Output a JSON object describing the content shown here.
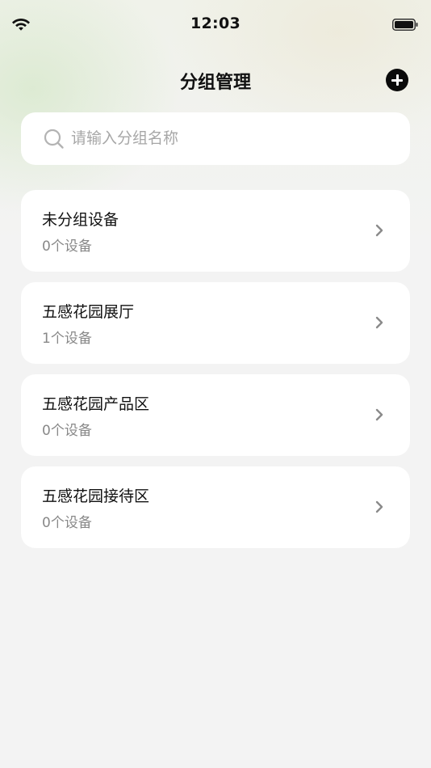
{
  "status_bar": {
    "time": "12:03"
  },
  "header": {
    "title": "分组管理",
    "add_icon": "plus-circle-icon"
  },
  "search": {
    "placeholder": "请输入分组名称",
    "value": "",
    "icon": "search-icon"
  },
  "groups": [
    {
      "name": "未分组设备",
      "count": "0个设备"
    },
    {
      "name": "五感花园展厅",
      "count": "1个设备"
    },
    {
      "name": "五感花园产品区",
      "count": "0个设备"
    },
    {
      "name": "五感花园接待区",
      "count": "0个设备"
    }
  ],
  "colors": {
    "background": "#f3f3f3",
    "card": "#ffffff",
    "primary_text": "#111111",
    "secondary_text": "#888888",
    "placeholder": "#a7a7a7"
  }
}
